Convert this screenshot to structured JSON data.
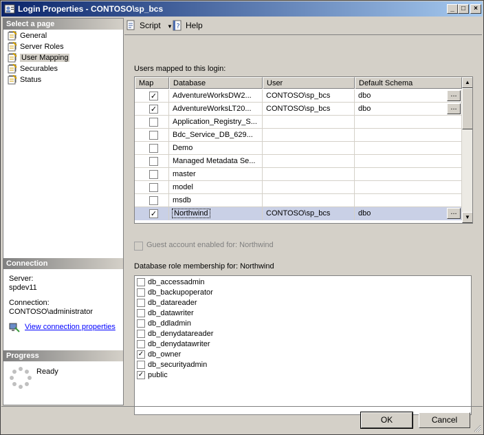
{
  "window": {
    "title": "Login Properties - CONTOSO\\sp_bcs"
  },
  "left": {
    "select_page_header": "Select a page",
    "pages": [
      {
        "label": "General",
        "icon": "page-icon"
      },
      {
        "label": "Server Roles",
        "icon": "page-icon"
      },
      {
        "label": "User Mapping",
        "icon": "page-icon"
      },
      {
        "label": "Securables",
        "icon": "page-icon"
      },
      {
        "label": "Status",
        "icon": "page-icon"
      }
    ],
    "selected_page": "User Mapping",
    "connection_header": "Connection",
    "server_label": "Server:",
    "server_value": "spdev11",
    "connection_label": "Connection:",
    "connection_value": "CONTOSO\\administrator",
    "view_connection_link": "View connection properties",
    "progress_header": "Progress",
    "progress_status": "Ready"
  },
  "toolbar": {
    "script_label": "Script",
    "help_label": "Help"
  },
  "mapping": {
    "users_label": "Users mapped to this login:",
    "columns": [
      "Map",
      "Database",
      "User",
      "Default Schema"
    ],
    "rows": [
      {
        "map": true,
        "database": "AdventureWorksDW2...",
        "user": "CONTOSO\\sp_bcs",
        "schema": "dbo",
        "has_btn": true
      },
      {
        "map": true,
        "database": "AdventureWorksLT20...",
        "user": "CONTOSO\\sp_bcs",
        "schema": "dbo",
        "has_btn": true
      },
      {
        "map": false,
        "database": "Application_Registry_S...",
        "user": "",
        "schema": "",
        "has_btn": false
      },
      {
        "map": false,
        "database": "Bdc_Service_DB_629...",
        "user": "",
        "schema": "",
        "has_btn": false
      },
      {
        "map": false,
        "database": "Demo",
        "user": "",
        "schema": "",
        "has_btn": false
      },
      {
        "map": false,
        "database": "Managed Metadata Se...",
        "user": "",
        "schema": "",
        "has_btn": false
      },
      {
        "map": false,
        "database": "master",
        "user": "",
        "schema": "",
        "has_btn": false
      },
      {
        "map": false,
        "database": "model",
        "user": "",
        "schema": "",
        "has_btn": false
      },
      {
        "map": false,
        "database": "msdb",
        "user": "",
        "schema": "",
        "has_btn": false
      },
      {
        "map": true,
        "database": "Northwind",
        "user": "CONTOSO\\sp_bcs",
        "schema": "dbo",
        "has_btn": true,
        "selected": true
      }
    ],
    "ellipsis": "...",
    "guest_label": "Guest account enabled for: Northwind",
    "roles_label": "Database role membership for: Northwind",
    "roles": [
      {
        "name": "db_accessadmin",
        "checked": false
      },
      {
        "name": "db_backupoperator",
        "checked": false
      },
      {
        "name": "db_datareader",
        "checked": false
      },
      {
        "name": "db_datawriter",
        "checked": false
      },
      {
        "name": "db_ddladmin",
        "checked": false
      },
      {
        "name": "db_denydatareader",
        "checked": false
      },
      {
        "name": "db_denydatawriter",
        "checked": false
      },
      {
        "name": "db_owner",
        "checked": true
      },
      {
        "name": "db_securityadmin",
        "checked": false
      },
      {
        "name": "public",
        "checked": true
      }
    ]
  },
  "buttons": {
    "ok": "OK",
    "cancel": "Cancel"
  }
}
